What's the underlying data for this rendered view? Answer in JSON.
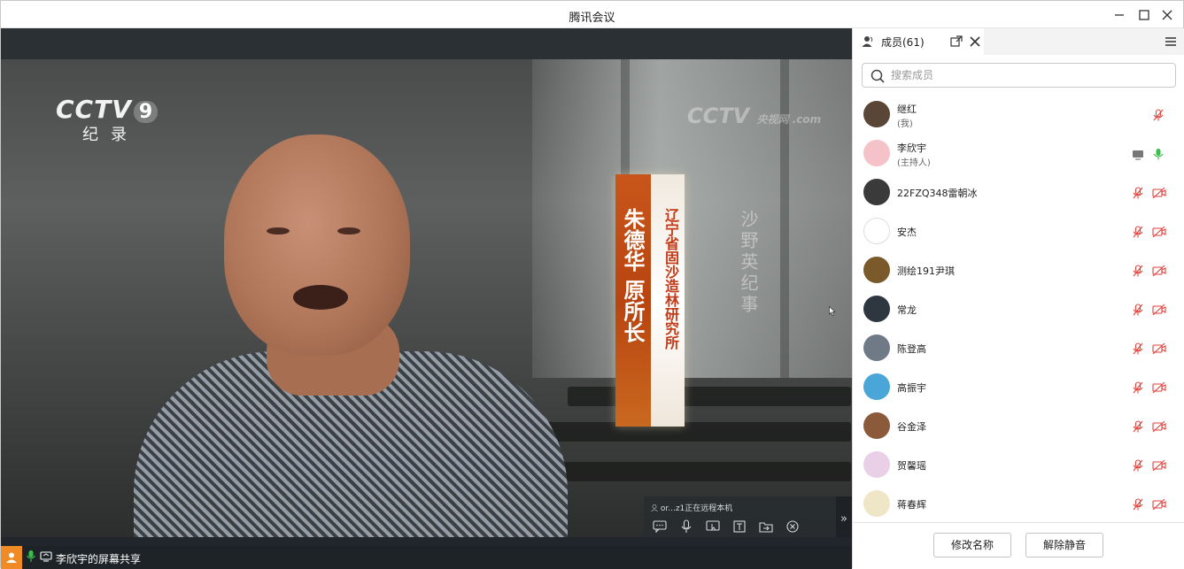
{
  "window": {
    "title": "腾讯会议"
  },
  "video": {
    "channel_logo": "CCTV",
    "channel_number": "9",
    "channel_sub": "纪录",
    "watermark": "CCTV",
    "watermark_sub": "央视网 .com",
    "nameplate_name": "朱德华 原所长",
    "nameplate_org": "辽宁省固沙造林研究所",
    "calligraphy": "沙野英纪事"
  },
  "remote_toolbar": {
    "status": "or...z1正在远程本机",
    "collapse_glyph": "»"
  },
  "statusbar": {
    "share_label": "李欣宇的屏幕共享"
  },
  "panel": {
    "tab_label": "成员(61)",
    "search_placeholder": "搜索成员",
    "members": [
      {
        "name": "继红",
        "role": "(我)",
        "avatar_color": "#5a4636",
        "mic": "muted-red",
        "cam": "none"
      },
      {
        "name": "李欣宇",
        "role": "(主持人)",
        "avatar_color": "#f4c2c8",
        "mic": "on-green",
        "cam": "screen"
      },
      {
        "name": "22FZQ348雷朝冰",
        "role": "",
        "avatar_color": "#3a3a3a",
        "mic": "muted-red",
        "cam": "off-red"
      },
      {
        "name": "安杰",
        "role": "",
        "avatar_color": "#ffffff",
        "mic": "muted-red",
        "cam": "off-red"
      },
      {
        "name": "测绘191尹琪",
        "role": "",
        "avatar_color": "#7a5a2a",
        "mic": "muted-red",
        "cam": "off-red"
      },
      {
        "name": "常龙",
        "role": "",
        "avatar_color": "#2e3640",
        "mic": "muted-red",
        "cam": "off-red"
      },
      {
        "name": "陈登高",
        "role": "",
        "avatar_color": "#6f7a86",
        "mic": "muted-red",
        "cam": "off-red"
      },
      {
        "name": "高振宇",
        "role": "",
        "avatar_color": "#4aa6d8",
        "mic": "muted-red",
        "cam": "off-red"
      },
      {
        "name": "谷金泽",
        "role": "",
        "avatar_color": "#8a5a3a",
        "mic": "muted-red",
        "cam": "off-red"
      },
      {
        "name": "贺馨瑶",
        "role": "",
        "avatar_color": "#e9d0e6",
        "mic": "muted-red",
        "cam": "off-red"
      },
      {
        "name": "蒋春辉",
        "role": "",
        "avatar_color": "#efe6c8",
        "mic": "muted-red",
        "cam": "off-red"
      }
    ],
    "footer": {
      "rename_label": "修改名称",
      "unmute_label": "解除静音"
    }
  },
  "colors": {
    "accent_orange": "#f08a24",
    "muted_red": "#e0413a",
    "mic_green": "#3bbf4a"
  }
}
